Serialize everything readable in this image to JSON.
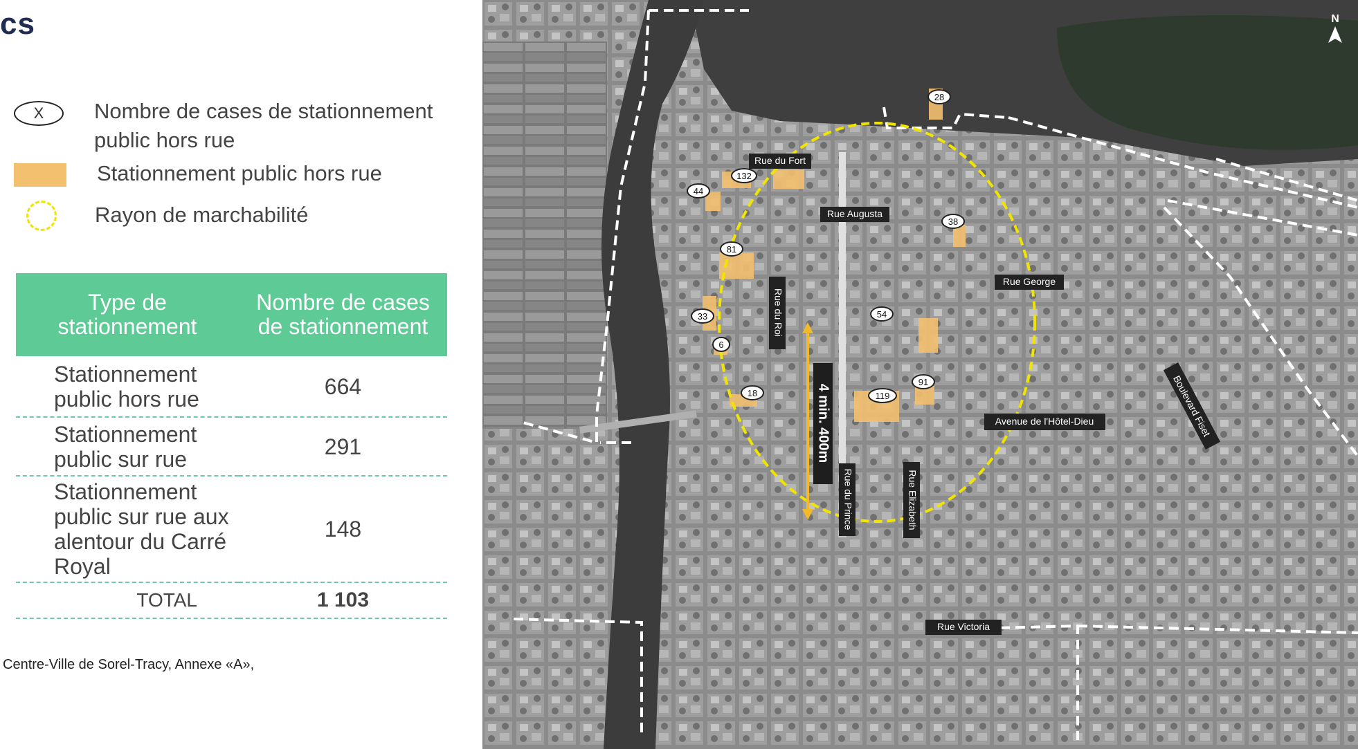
{
  "title": "cs",
  "legend": {
    "count_symbol": "X",
    "count_label": "Nombre de cases de stationnement public hors rue",
    "lot_label": "Stationnement public hors rue",
    "radius_label": "Rayon de marchabilité"
  },
  "table": {
    "headers": [
      "Type de stationnement",
      "Nombre de cases de stationnement"
    ],
    "rows": [
      {
        "type": "Stationnement public hors rue",
        "count": "664"
      },
      {
        "type": "Stationnement public sur rue",
        "count": "291"
      },
      {
        "type": "Stationnement public sur rue aux alentour du Carré Royal",
        "count": "148"
      }
    ],
    "total_label": "TOTAL",
    "total_value": "1 103"
  },
  "source": "Centre-Ville de Sorel-Tracy, Annexe «A»,",
  "map": {
    "north": "N",
    "walk_label": "4 min. 400m",
    "streets": [
      "Rue du Fort",
      "Rue Augusta",
      "Rue George",
      "Rue du Roi",
      "Avenue de l'Hôtel-Dieu",
      "Boulevard Fiset",
      "Rue du Prince",
      "Rue Elizabeth",
      "Rue Victoria"
    ],
    "lot_counts": [
      "28",
      "132",
      "44",
      "38",
      "81",
      "33",
      "6",
      "54",
      "119",
      "91",
      "18"
    ],
    "colors": {
      "lot": "#f3c06f",
      "walk_radius": "#f0e400",
      "boundary": "#ffffff"
    }
  }
}
